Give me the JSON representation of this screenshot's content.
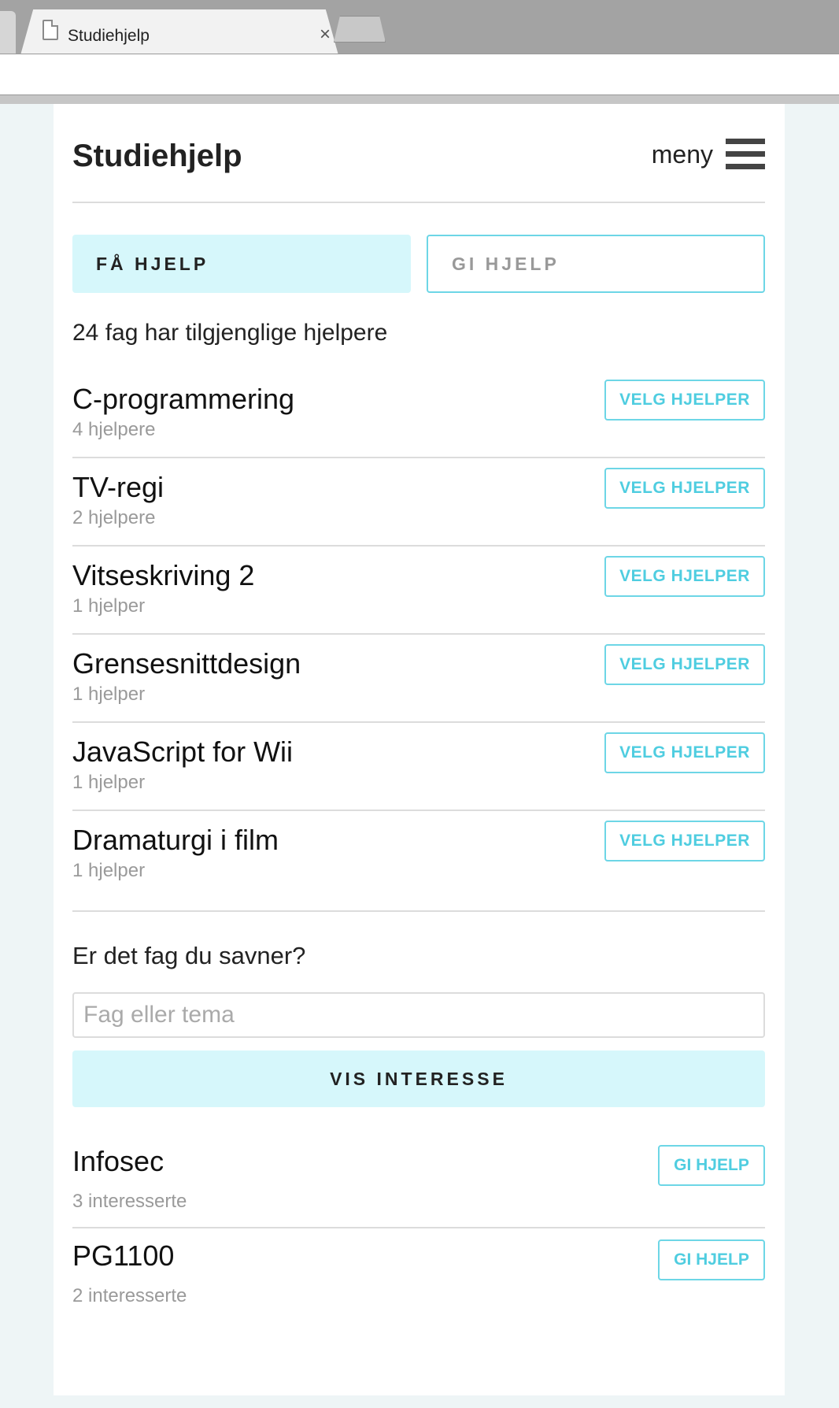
{
  "browser": {
    "tab_title": "Studiehjelp",
    "tab_close": "×",
    "prev_tab_close": "×"
  },
  "header": {
    "title": "Studiehjelp",
    "menu_label": "meny"
  },
  "toggle": {
    "get_help": "FÅ HJELP",
    "give_help": "GI HJELP"
  },
  "available_count": "24 fag har tilgjenglige hjelpere",
  "subjects": [
    {
      "name": "C-programmering",
      "count": "4 hjelpere",
      "button": "VELG HJELPER"
    },
    {
      "name": "TV-regi",
      "count": "2 hjelpere",
      "button": "VELG HJELPER"
    },
    {
      "name": "Vitseskriving 2",
      "count": "1 hjelper",
      "button": "VELG HJELPER"
    },
    {
      "name": "Grensesnittdesign",
      "count": "1 hjelper",
      "button": "VELG HJELPER"
    },
    {
      "name": "JavaScript for Wii",
      "count": "1 hjelper",
      "button": "VELG HJELPER"
    },
    {
      "name": "Dramaturgi i film",
      "count": "1 hjelper",
      "button": "VELG HJELPER"
    }
  ],
  "missing": {
    "title": "Er det fag du savner?",
    "placeholder": "Fag eller tema",
    "value": "",
    "button": "VIS INTERESSE"
  },
  "interests": [
    {
      "name": "Infosec",
      "count": "3 interesserte",
      "button": "GI HJELP"
    },
    {
      "name": "PG1100",
      "count": "2 interesserte",
      "button": "GI HJELP"
    }
  ],
  "colors": {
    "accent": "#6dd6e6",
    "accent_text": "#4fcde0",
    "active_bg": "#d6f7fb",
    "page_bg": "#eef5f6"
  },
  "icons": {
    "tab": "document-icon",
    "menu": "hamburger-menu-icon"
  }
}
